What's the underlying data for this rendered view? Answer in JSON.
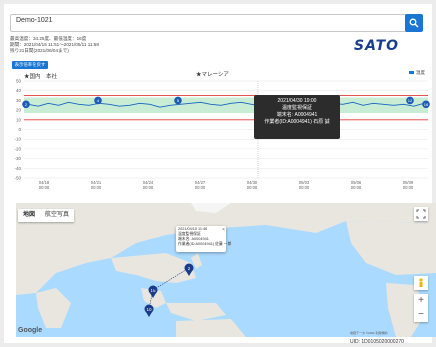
{
  "header": {
    "device_name": "Demo-1021",
    "logo_text": "SATO",
    "info_line1": "最高温度：34.25度、最低温度：16度",
    "info_line2": "期間：2021/04/15 11:51〜2021/05/11 11:58",
    "info_line3": "残り21日間(2021/06/04まで)",
    "reset_button": "表示倍率を戻す"
  },
  "chart_annotations": {
    "label_japan": "★国内　本社",
    "label_malaysia": "★マレーシア",
    "legend_label": "温度"
  },
  "tooltip": {
    "datetime": "2021/04/30 19:00",
    "status": "温度監視保証",
    "terminal": "端末名: A0004941",
    "worker": "作業者(ID:A0004941) 石原 誠"
  },
  "chart_data": {
    "type": "line",
    "xlabel": "",
    "ylabel": "",
    "ylim": [
      -50,
      50
    ],
    "yticks": [
      50,
      40,
      30,
      20,
      10,
      0,
      -10,
      -20,
      -30,
      -40,
      -50
    ],
    "xticks": [
      "04/18\n00:00",
      "04/21\n00:00",
      "04/24\n00:00",
      "04/27\n00:00",
      "04/30\n00:00",
      "05/03\n00:00",
      "05/06\n00:00",
      "05/09\n00:00"
    ],
    "threshold_upper": 35,
    "threshold_lower": 10,
    "band": [
      17,
      33
    ],
    "series": [
      {
        "name": "温度",
        "values": [
          26,
          24,
          27,
          25,
          28,
          26,
          25,
          27,
          26,
          24,
          25,
          27,
          26,
          23,
          25,
          26,
          27,
          28,
          26,
          25,
          27,
          28,
          26,
          24,
          25,
          27,
          29,
          27,
          26,
          25,
          27,
          26,
          28,
          25,
          27,
          26,
          25,
          26,
          24,
          27
        ]
      }
    ],
    "markers": [
      {
        "label": "2",
        "value": 26
      },
      {
        "label": "4",
        "value": 30
      },
      {
        "label": "5",
        "value": 30
      },
      {
        "label": "14",
        "value": 28
      },
      {
        "label": "12",
        "value": 30
      },
      {
        "label": "16",
        "value": 26
      }
    ]
  },
  "map": {
    "tab_map": "地図",
    "tab_satellite": "航空写真",
    "infowindow_line1": "2021/04/15 11:46",
    "infowindow_line2": "温度監視保証",
    "infowindow_line3": "端末名: A0004941",
    "infowindow_line4": "作業者(ID:A0004941) 佐藤 一郎",
    "marker_labels": [
      "2",
      "15",
      "10"
    ],
    "google_logo": "Google",
    "copyright": "地図データ ©2021 利用規約",
    "zoom_in": "+",
    "zoom_out": "−"
  },
  "footer": {
    "uid": "UID: 1D0105020000270"
  }
}
